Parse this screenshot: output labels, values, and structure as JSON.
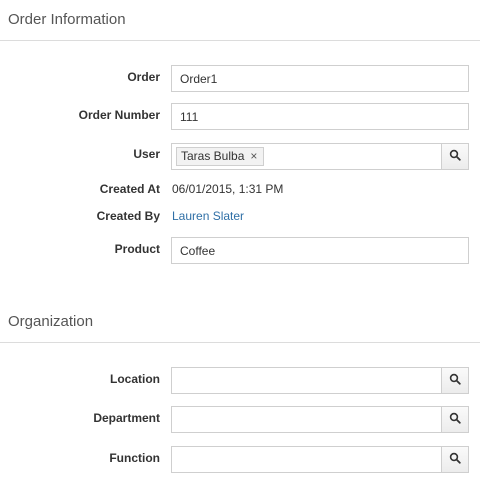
{
  "order_info": {
    "title": "Order Information",
    "order_label": "Order",
    "order_value": "Order1",
    "order_number_label": "Order Number",
    "order_number_value": "111",
    "user_label": "User",
    "user_value": "Taras Bulba",
    "user_remove_glyph": "×",
    "created_at_label": "Created At",
    "created_at_value": "06/01/2015, 1:31 PM",
    "created_by_label": "Created By",
    "created_by_value": "Lauren Slater",
    "product_label": "Product",
    "product_value": "Coffee"
  },
  "organization": {
    "title": "Organization",
    "location_label": "Location",
    "location_value": "",
    "department_label": "Department",
    "department_value": "",
    "function_label": "Function",
    "function_value": ""
  },
  "icons": {
    "lookup": "search-icon",
    "remove": "close-icon"
  },
  "colors": {
    "link": "#2f6fa6",
    "border": "#cfcfcf",
    "divider": "#dcdcdc"
  }
}
